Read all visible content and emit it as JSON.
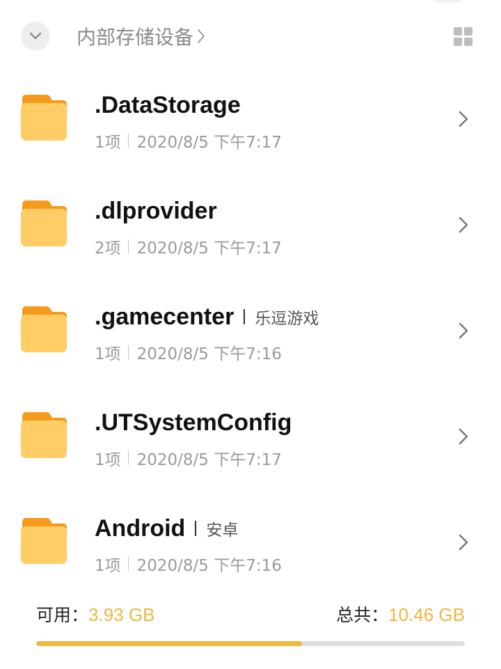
{
  "header": {
    "breadcrumb": "内部存储设备",
    "icons": {
      "collapse": "chevron-down-icon",
      "breadcrumb_arrow": "chevron-right-icon",
      "view_toggle": "grid-view-icon"
    }
  },
  "files": [
    {
      "name": ".DataStorage",
      "app": "",
      "count": "1项",
      "modified": "2020/8/5 下午7:17"
    },
    {
      "name": ".dlprovider",
      "app": "",
      "count": "2项",
      "modified": "2020/8/5 下午7:17"
    },
    {
      "name": ".gamecenter",
      "app": "乐逗游戏",
      "count": "1项",
      "modified": "2020/8/5 下午7:16"
    },
    {
      "name": ".UTSystemConfig",
      "app": "",
      "count": "1项",
      "modified": "2020/8/5 下午7:17"
    },
    {
      "name": "Android",
      "app": "安卓",
      "count": "1项",
      "modified": "2020/8/5 下午7:16"
    }
  ],
  "storage": {
    "available_label": "可用：",
    "available_value": "3.93 GB",
    "total_label": "总共：",
    "total_value": "10.46 GB",
    "used_fraction": 0.62
  },
  "colors": {
    "accent": "#f0b63e",
    "folder_body": "#ffcc66",
    "folder_tab": "#f59b1c"
  }
}
